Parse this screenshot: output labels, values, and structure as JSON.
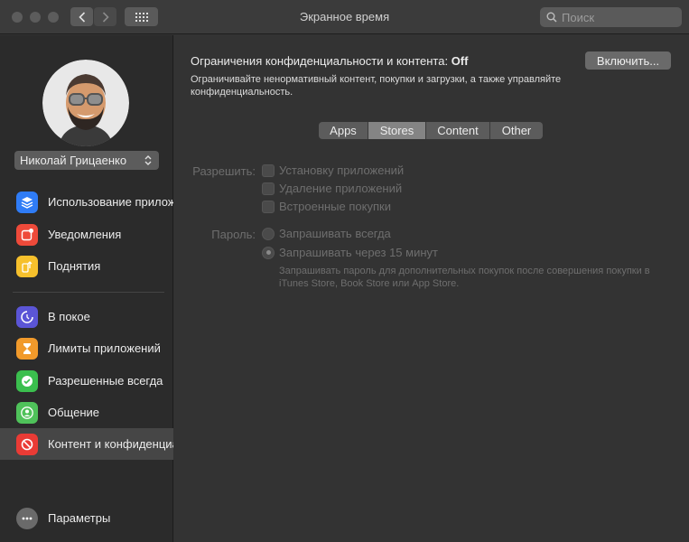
{
  "window": {
    "title": "Экранное время"
  },
  "search": {
    "placeholder": "Поиск"
  },
  "user": {
    "name": "Николай Грицаенко"
  },
  "sidebar": {
    "items": [
      {
        "label": "Использование приложений",
        "icon": "layers-icon",
        "color": "#2f7cf6"
      },
      {
        "label": "Уведомления",
        "icon": "notification-icon",
        "color": "#ee4a3a"
      },
      {
        "label": "Поднятия",
        "icon": "pickups-icon",
        "color": "#f6c02c"
      },
      {
        "label": "В покое",
        "icon": "downtime-icon",
        "color": "#5b55d6"
      },
      {
        "label": "Лимиты приложений",
        "icon": "hourglass-icon",
        "color": "#f19a2b"
      },
      {
        "label": "Разрешенные всегда",
        "icon": "checkmark-badge-icon",
        "color": "#3bbf4e"
      },
      {
        "label": "Общение",
        "icon": "person-icon",
        "color": "#4fc25a"
      },
      {
        "label": "Контент и конфиденциальность",
        "icon": "restriction-icon",
        "color": "#ea3b35"
      }
    ],
    "options": {
      "label": "Параметры",
      "icon": "more-icon"
    }
  },
  "main": {
    "heading_prefix": "Ограничения конфиденциальности и контента:",
    "heading_status": "Off",
    "description": "Ограничивайте ненормативный контент, покупки и загрузки, а также управляйте конфиденциальность.",
    "enable_button": "Включить...",
    "tabs": [
      "Apps",
      "Stores",
      "Content",
      "Other"
    ],
    "selected_tab": "Stores",
    "allow_label": "Разрешить:",
    "allow_options": [
      "Установку приложений",
      "Удаление приложений",
      "Встроенные покупки"
    ],
    "password_label": "Пароль:",
    "password_options": [
      "Запрашивать всегда",
      "Запрашивать через 15 минут"
    ],
    "password_selected": "Запрашивать через 15 минут",
    "password_note": "Запрашивать пароль для дополнительных покупок после совершения покупки в iTunes Store, Book Store или App Store."
  }
}
